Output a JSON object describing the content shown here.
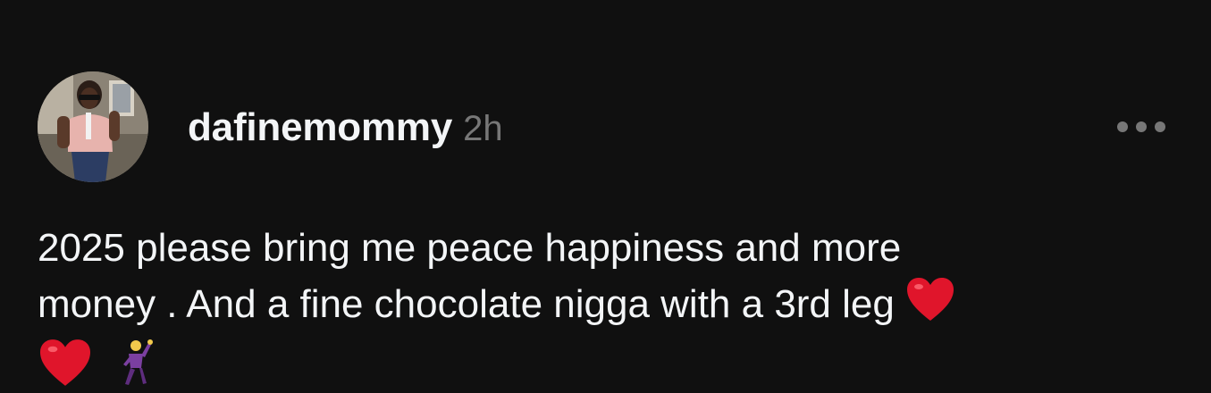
{
  "post": {
    "author": {
      "username": "dafinemommy",
      "timestamp": "2h",
      "avatar_icon": "profile-photo"
    },
    "more_icon": "more-horizontal-icon",
    "text_line1": "2025 please bring me peace happiness and more",
    "text_line2": "money . And a fine chocolate nigga with a 3rd leg",
    "emojis": [
      "red-heart",
      "red-heart",
      "dancing-man"
    ]
  },
  "colors": {
    "background": "#101010",
    "primary_text": "#f3f5f7",
    "secondary_text": "#777777",
    "heart": "#e0152b",
    "dancer": "#7b3fa0"
  }
}
